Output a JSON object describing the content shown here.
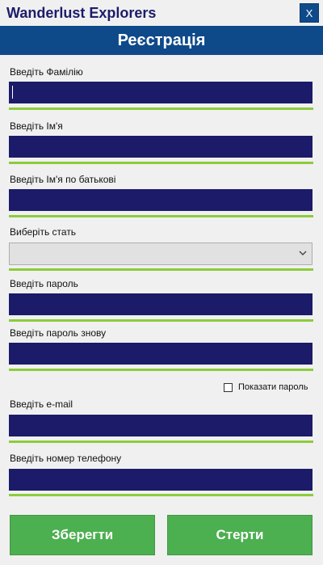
{
  "app": {
    "title": "Wanderlust Explorers",
    "close_label": "X"
  },
  "form": {
    "heading": "Реєстрація",
    "surname_label": "Введіть Фамілію",
    "surname_value": "",
    "name_label": "Введіть Ім'я",
    "name_value": "",
    "patronymic_label": "Введіть Ім'я по батькові",
    "patronymic_value": "",
    "gender_label": "Виберіть стать",
    "gender_value": "",
    "password_label": "Введіть пароль",
    "password_value": "",
    "password_repeat_label": "Введіть пароль знову",
    "password_repeat_value": "",
    "show_password_label": "Показати пароль",
    "show_password_checked": false,
    "email_label": "Введіть e-mail",
    "email_value": "",
    "phone_label": "Введіть номер телефону",
    "phone_value": ""
  },
  "buttons": {
    "save": "Зберегти",
    "clear": "Стерти"
  },
  "colors": {
    "accent_blue": "#0e4a8a",
    "field_navy": "#1b1b69",
    "underline_green": "#8ccc3c",
    "button_green": "#4caf50"
  }
}
